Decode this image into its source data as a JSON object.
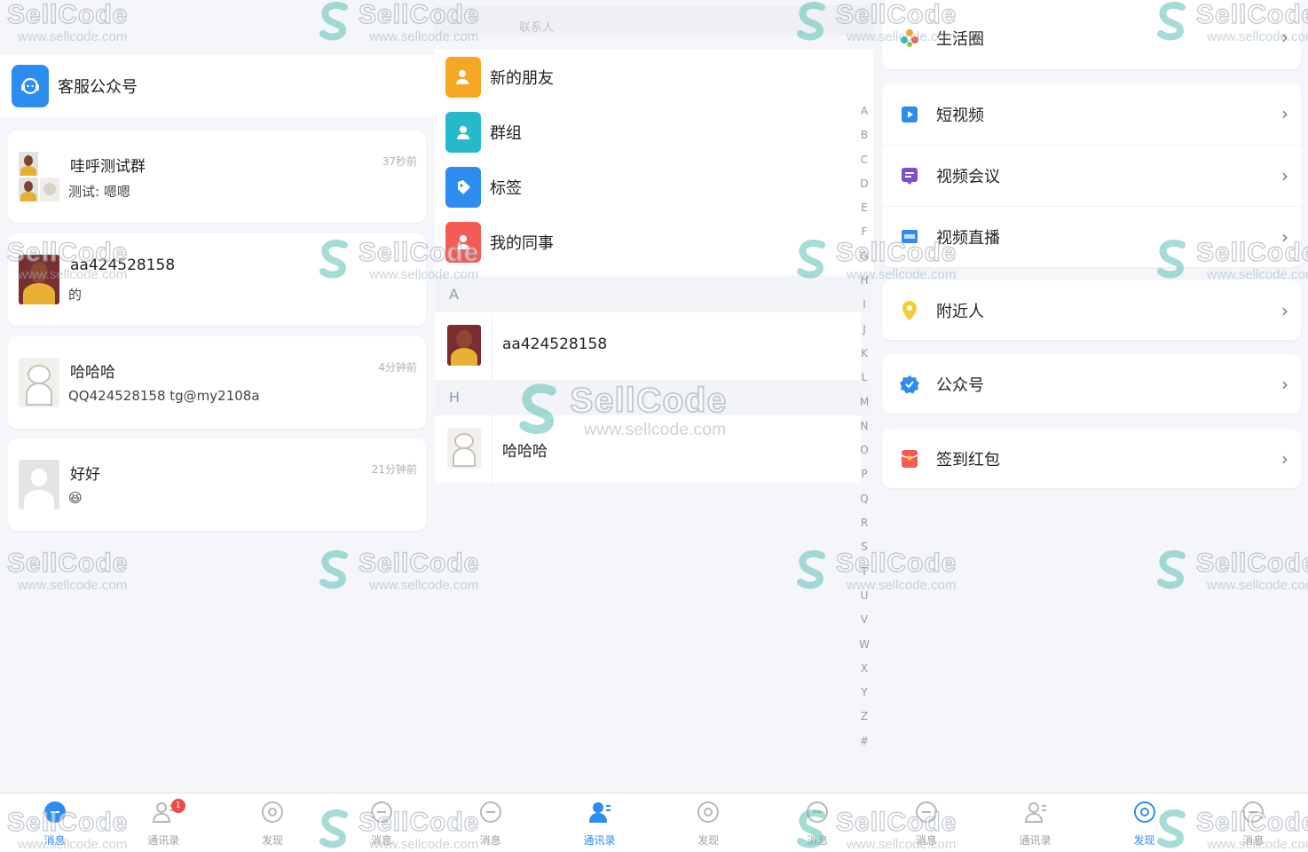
{
  "messages_panel": {
    "service_label": "客服公众号",
    "chats": [
      {
        "title": "哇呼测试群",
        "preview": "测试: 嗯嗯",
        "time": "37秒前"
      },
      {
        "title": "aa424528158",
        "preview": "的",
        "time": ""
      },
      {
        "title": "哈哈哈",
        "preview": "QQ424528158 tg@my2108a",
        "time": "4分钟前"
      },
      {
        "title": "好好",
        "preview": "😆",
        "time": "21分钟前"
      }
    ]
  },
  "contacts_panel": {
    "search_hint": "联系人",
    "menu": [
      {
        "label": "新的朋友",
        "color": "#f5a623",
        "icon": "user-add-icon"
      },
      {
        "label": "群组",
        "color": "#26b9c9",
        "icon": "group-icon"
      },
      {
        "label": "标签",
        "color": "#2d8cf0",
        "icon": "tag-icon"
      },
      {
        "label": "我的同事",
        "color": "#f25c54",
        "icon": "colleague-icon"
      }
    ],
    "sections": [
      {
        "letter": "A",
        "contact": "aa424528158"
      },
      {
        "letter": "H",
        "contact": "哈哈哈"
      }
    ],
    "index_letters": [
      "A",
      "B",
      "C",
      "D",
      "E",
      "F",
      "G",
      "H",
      "I",
      "J",
      "K",
      "L",
      "M",
      "N",
      "O",
      "P",
      "Q",
      "R",
      "S",
      "T",
      "U",
      "V",
      "W",
      "X",
      "Y",
      "Z",
      "#"
    ]
  },
  "discover_panel": {
    "moments": "生活圈",
    "short_video": "短视频",
    "video_meeting": "视频会议",
    "live": "视频直播",
    "nearby": "附近人",
    "official_accounts": "公众号",
    "checkin": "签到红包"
  },
  "tabbar": {
    "tabs": [
      "消息",
      "通讯录",
      "发现",
      "消息",
      "消息",
      "通讯录",
      "发现",
      "消息",
      "消息",
      "通讯录",
      "发现",
      "消息"
    ],
    "badge": "1"
  },
  "watermark": {
    "brand": "SellCode",
    "url": "www.sellcode.com"
  },
  "colors": {
    "accent": "#2d8cf0",
    "badge": "#f04848",
    "background": "#f5f6fa"
  }
}
